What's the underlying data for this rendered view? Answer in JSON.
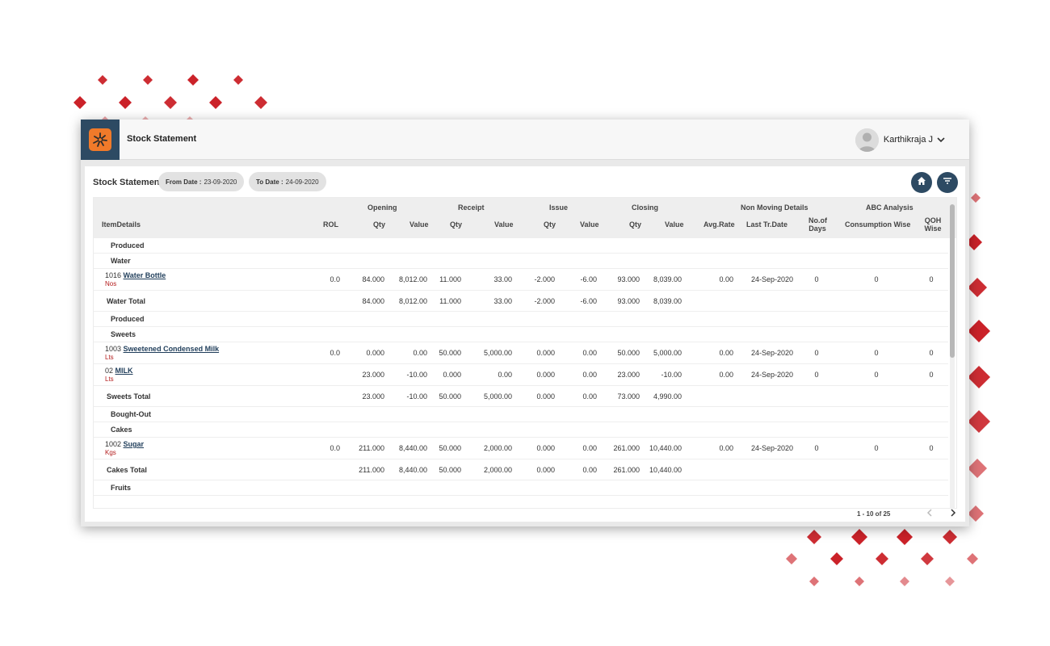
{
  "app": {
    "title": "Stock Statement",
    "user_name": "Karthikraja J"
  },
  "report": {
    "title": "Stock Statement",
    "from_label": "From Date :",
    "from_value": "23-09-2020",
    "to_label": "To Date :",
    "to_value": "24-09-2020"
  },
  "table": {
    "group_headers": {
      "opening": "Opening",
      "receipt": "Receipt",
      "issue": "Issue",
      "closing": "Closing",
      "non_moving": "Non Moving Details",
      "abc": "ABC Analysis"
    },
    "columns": {
      "item_details": "ItemDetails",
      "rol": "ROL",
      "op_qty": "Qty",
      "op_value": "Value",
      "rc_qty": "Qty",
      "rc_value": "Value",
      "is_qty": "Qty",
      "is_value": "Value",
      "cl_qty": "Qty",
      "cl_value": "Value",
      "avg_rate": "Avg.Rate",
      "last_tr_date": "Last Tr.Date",
      "no_of_days_1": "No.of",
      "no_of_days_2": "Days",
      "consumption_wise": "Consumption Wise",
      "qoh_wise_1": "QOH",
      "qoh_wise_2": "Wise"
    },
    "rows": [
      {
        "type": "group",
        "label": "Produced"
      },
      {
        "type": "group",
        "label": "Water"
      },
      {
        "type": "item",
        "code": "1016",
        "name": "Water Bottle",
        "unit": "Nos",
        "rol": "0.0",
        "op_qty": "84.000",
        "op_value": "8,012.00",
        "rc_qty": "11.000",
        "rc_value": "33.00",
        "is_qty": "-2.000",
        "is_value": "-6.00",
        "cl_qty": "93.000",
        "cl_value": "8,039.00",
        "avg_rate": "0.00",
        "last_date": "24-Sep-2020",
        "days": "0",
        "consumption": "0",
        "qoh": "0"
      },
      {
        "type": "total",
        "label": "Water Total",
        "op_qty": "84.000",
        "op_value": "8,012.00",
        "rc_qty": "11.000",
        "rc_value": "33.00",
        "is_qty": "-2.000",
        "is_value": "-6.00",
        "cl_qty": "93.000",
        "cl_value": "8,039.00"
      },
      {
        "type": "group",
        "label": "Produced"
      },
      {
        "type": "group",
        "label": "Sweets"
      },
      {
        "type": "item",
        "code": "1003",
        "name": "Sweetened Condensed Milk",
        "unit": "Lts",
        "rol": "0.0",
        "op_qty": "0.000",
        "op_value": "0.00",
        "rc_qty": "50.000",
        "rc_value": "5,000.00",
        "is_qty": "0.000",
        "is_value": "0.00",
        "cl_qty": "50.000",
        "cl_value": "5,000.00",
        "avg_rate": "0.00",
        "last_date": "24-Sep-2020",
        "days": "0",
        "consumption": "0",
        "qoh": "0"
      },
      {
        "type": "item",
        "code": "02",
        "name": "MILK",
        "unit": "Lts",
        "rol": "",
        "op_qty": "23.000",
        "op_value": "-10.00",
        "rc_qty": "0.000",
        "rc_value": "0.00",
        "is_qty": "0.000",
        "is_value": "0.00",
        "cl_qty": "23.000",
        "cl_value": "-10.00",
        "avg_rate": "0.00",
        "last_date": "24-Sep-2020",
        "days": "0",
        "consumption": "0",
        "qoh": "0"
      },
      {
        "type": "total",
        "label": "Sweets Total",
        "op_qty": "23.000",
        "op_value": "-10.00",
        "rc_qty": "50.000",
        "rc_value": "5,000.00",
        "is_qty": "0.000",
        "is_value": "0.00",
        "cl_qty": "73.000",
        "cl_value": "4,990.00"
      },
      {
        "type": "group",
        "label": "Bought-Out"
      },
      {
        "type": "group",
        "label": "Cakes"
      },
      {
        "type": "item",
        "code": "1002",
        "name": "Sugar",
        "unit": "Kgs",
        "rol": "0.0",
        "op_qty": "211.000",
        "op_value": "8,440.00",
        "rc_qty": "50.000",
        "rc_value": "2,000.00",
        "is_qty": "0.000",
        "is_value": "0.00",
        "cl_qty": "261.000",
        "cl_value": "10,440.00",
        "avg_rate": "0.00",
        "last_date": "24-Sep-2020",
        "days": "0",
        "consumption": "0",
        "qoh": "0"
      },
      {
        "type": "total",
        "label": "Cakes Total",
        "op_qty": "211.000",
        "op_value": "8,440.00",
        "rc_qty": "50.000",
        "rc_value": "2,000.00",
        "is_qty": "0.000",
        "is_value": "0.00",
        "cl_qty": "261.000",
        "cl_value": "10,440.00"
      },
      {
        "type": "group",
        "label": "Fruits"
      }
    ]
  },
  "pagination": {
    "range": "1 - 10 of 25"
  },
  "colors": {
    "accent": "#2d4a63",
    "logo": "#f07a2a",
    "unit": "#b31b1b",
    "decor": "#c8161d"
  },
  "icons": {
    "home": "home-icon",
    "filter": "filter-icon",
    "chevron": "chevron-down-icon",
    "prev": "chevron-left-icon",
    "next": "chevron-right-icon"
  }
}
